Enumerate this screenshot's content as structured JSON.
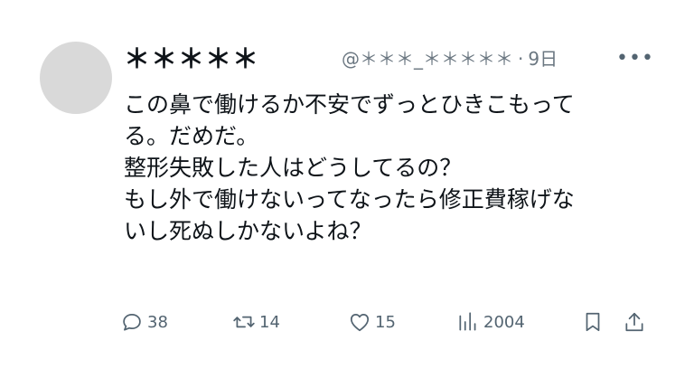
{
  "tweet": {
    "display_name": "＊＊＊＊＊",
    "handle": "@＊＊＊_＊＊＊＊＊",
    "separator": "·",
    "time": "9日",
    "more_label": "•••",
    "text_lines": [
      "この鼻で働けるか不安でずっとひきこもって",
      "る。だめだ。",
      " 整形失敗した人はどうしてるの？",
      " もし外で働けないってなったら修正費稼げな",
      "いし死ぬしかないよね？"
    ]
  },
  "actions": {
    "reply": {
      "icon": "reply-icon",
      "count": "38"
    },
    "retweet": {
      "icon": "retweet-icon",
      "count": "14"
    },
    "like": {
      "icon": "heart-icon",
      "count": "15"
    },
    "views": {
      "icon": "views-icon",
      "count": "2004"
    },
    "bookmark": {
      "icon": "bookmark-icon"
    },
    "share": {
      "icon": "share-icon"
    }
  },
  "colors": {
    "text": "#0f1419",
    "secondary": "#536471",
    "avatar_placeholder": "#d9d9d9"
  }
}
